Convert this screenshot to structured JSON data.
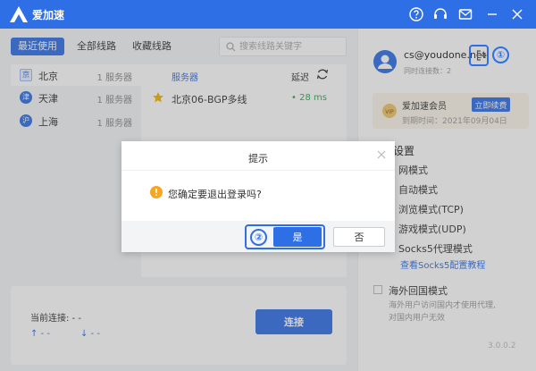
{
  "app": {
    "title": "爱加速"
  },
  "left": {
    "tabs": [
      "最近使用",
      "全部线路",
      "收藏线路"
    ],
    "search": {
      "placeholder": "搜索线路关键字"
    },
    "regions": [
      {
        "badge": "京",
        "name": "北京",
        "count": "1 服务器"
      },
      {
        "badge": "津",
        "name": "天津",
        "count": "1 服务器"
      },
      {
        "badge": "沪",
        "name": "上海",
        "count": "1 服务器"
      }
    ],
    "server_header": {
      "name": "服务器",
      "latency": "延迟"
    },
    "servers": [
      {
        "name": "北京06-BGP多线",
        "latency": "• 28 ms"
      }
    ],
    "connection": {
      "label": "当前连接: - -",
      "up": "↑ - -",
      "down": "↓ - -",
      "button": "连接"
    }
  },
  "right": {
    "email": "cs@youdone.net",
    "simultaneous": "同时连接数：2",
    "member": {
      "title": "爱加速会员",
      "renew": "立即续费",
      "expire": "到期时间：2021年09月04日"
    },
    "settings_title": "设置",
    "modes": [
      "网模式",
      "自动模式",
      "浏览模式(TCP)",
      "游戏模式(UDP)",
      "Socks5代理模式"
    ],
    "socks_link": "查看Socks5配置教程",
    "overseas": {
      "title": "海外回国模式",
      "desc": [
        "海外用户访问国内才使用代理,",
        "对国内用户无效"
      ]
    },
    "version": "3.0.0.2"
  },
  "dialog": {
    "title": "提示",
    "message": "您确定要退出登录吗?",
    "yes": "是",
    "no": "否"
  },
  "callouts": [
    "①",
    "②"
  ],
  "colors": {
    "accent": "#2f6fe6",
    "latency": "#22b14c",
    "warning": "#f5a623"
  }
}
